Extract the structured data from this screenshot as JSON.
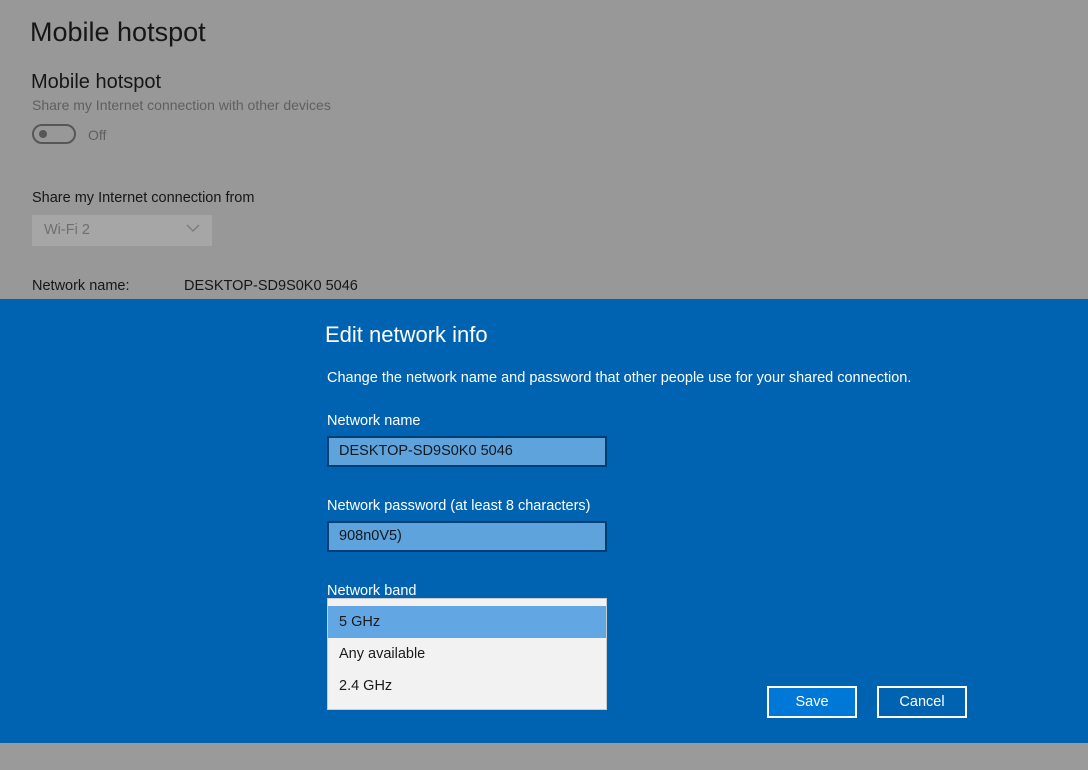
{
  "page": {
    "title": "Mobile hotspot",
    "section_title": "Mobile hotspot",
    "section_desc": "Share my Internet connection with other devices",
    "toggle_state": "Off",
    "share_from_label": "Share my Internet connection from",
    "share_from_value": "Wi-Fi 2",
    "network_name_label": "Network name:",
    "network_name_value": "DESKTOP-SD9S0K0 5046"
  },
  "dialog": {
    "title": "Edit network info",
    "description": "Change the network name and password that other people use for your shared connection.",
    "name_label": "Network name",
    "name_value": "DESKTOP-SD9S0K0 5046",
    "password_label": "Network password (at least 8 characters)",
    "password_value": "908n0V5)",
    "band_label": "Network band",
    "band_options": [
      "5 GHz",
      "Any available",
      "2.4 GHz"
    ],
    "band_selected": "5 GHz",
    "save_label": "Save",
    "cancel_label": "Cancel"
  },
  "colors": {
    "dialog_background": "#0063b1",
    "save_button": "#0078d7",
    "selected_option": "#62a7e3",
    "overlay": "#989898"
  }
}
